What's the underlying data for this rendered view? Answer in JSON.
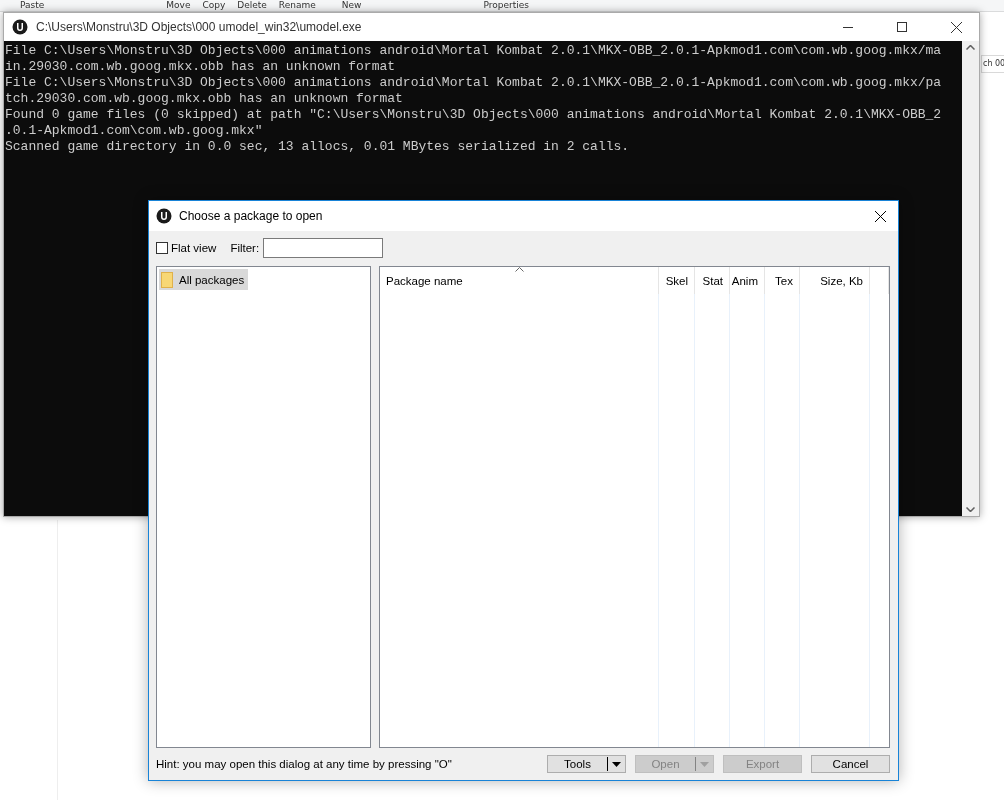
{
  "background_window": {
    "ribbon_items": [
      "Paste",
      "Move",
      "Copy",
      "Delete",
      "Rename",
      "New",
      "Properties"
    ],
    "search_field": {
      "value": "ch 00"
    }
  },
  "console_window": {
    "title": "C:\\Users\\Monstru\\3D Objects\\000 umodel_win32\\umodel.exe",
    "lines": [
      "File C:\\Users\\Monstru\\3D Objects\\000 animations android\\Mortal Kombat 2.0.1\\MKX-OBB_2.0.1-Apkmod1.com\\com.wb.goog.mkx/ma",
      "in.29030.com.wb.goog.mkx.obb has an unknown format",
      "File C:\\Users\\Monstru\\3D Objects\\000 animations android\\Mortal Kombat 2.0.1\\MKX-OBB_2.0.1-Apkmod1.com\\com.wb.goog.mkx/pa",
      "tch.29030.com.wb.goog.mkx.obb has an unknown format",
      "Found 0 game files (0 skipped) at path \"C:\\Users\\Monstru\\3D Objects\\000 animations android\\Mortal Kombat 2.0.1\\MKX-OBB_2",
      ".0.1-Apkmod1.com\\com.wb.goog.mkx\"",
      "Scanned game directory in 0.0 sec, 13 allocs, 0.01 MBytes serialized in 2 calls."
    ]
  },
  "dialog": {
    "title": "Choose a package to open",
    "flat_view": {
      "label": "Flat view",
      "checked": false
    },
    "filter": {
      "label": "Filter:"
    },
    "tree": [
      {
        "label": "All packages",
        "selected": true
      }
    ],
    "columns": [
      {
        "label": "Package name",
        "sorted": true
      },
      {
        "label": "Skel",
        "sorted": false
      },
      {
        "label": "Stat",
        "sorted": false
      },
      {
        "label": "Anim",
        "sorted": false
      },
      {
        "label": "Tex",
        "sorted": false
      },
      {
        "label": "Size, Kb",
        "sorted": false
      }
    ],
    "hint": "Hint: you may open this dialog at any time by pressing \"O\"",
    "buttons": [
      {
        "label": "Tools",
        "kind": "split",
        "disabled": false
      },
      {
        "label": "Open",
        "kind": "split",
        "disabled": true
      },
      {
        "label": "Export",
        "kind": "plain",
        "disabled": true
      },
      {
        "label": "Cancel",
        "kind": "plain",
        "disabled": false
      }
    ]
  }
}
